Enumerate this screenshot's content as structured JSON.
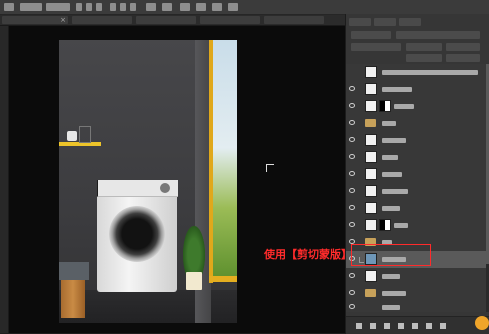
{
  "app": {
    "title": "",
    "menu_labels": []
  },
  "document_tab": {
    "label": ""
  },
  "canvas": {
    "caption": "使用【剪切蒙版】",
    "caption_color": "#ff2b2b",
    "highlight_color": "#ff2b2b"
  },
  "layers_panel": {
    "tab_labels": [
      "",
      "",
      ""
    ],
    "blend_mode": "",
    "opacity_label": "",
    "fill_label": "",
    "layers": [
      {
        "kind": "smart",
        "name": ""
      },
      {
        "kind": "image",
        "name": ""
      },
      {
        "kind": "masked",
        "name": ""
      },
      {
        "kind": "group",
        "name": ""
      },
      {
        "kind": "image",
        "name": ""
      },
      {
        "kind": "image",
        "name": ""
      },
      {
        "kind": "image",
        "name": ""
      },
      {
        "kind": "image",
        "name": ""
      },
      {
        "kind": "image",
        "name": ""
      },
      {
        "kind": "masked",
        "name": ""
      },
      {
        "kind": "group",
        "name": ""
      },
      {
        "kind": "clipped-selected",
        "name": ""
      },
      {
        "kind": "image",
        "name": ""
      },
      {
        "kind": "group",
        "name": ""
      },
      {
        "kind": "image",
        "name": ""
      },
      {
        "kind": "image",
        "name": ""
      }
    ]
  },
  "icons": [
    "eye-icon",
    "folder-icon",
    "clipping-arrow-icon",
    "link-icon",
    "fx-icon",
    "mask-icon",
    "adjustment-icon",
    "new-group-icon",
    "new-layer-icon",
    "trash-icon"
  ]
}
